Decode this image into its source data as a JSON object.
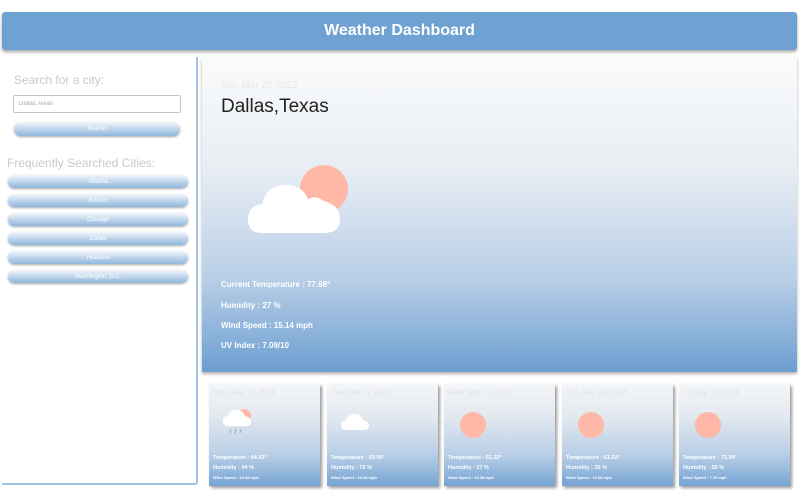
{
  "header": {
    "title": "Weather Dashboard"
  },
  "sidebar": {
    "search_label": "Search for a city:",
    "search_input_value": "Dallas,Texas",
    "search_button": "Search",
    "frequent_label": "Frequently Searched Cities:",
    "cities": [
      "Atlanta",
      "Boston",
      "Chicago",
      "Dallas",
      "Houston",
      "Washington, D.C."
    ]
  },
  "current": {
    "date": "Sun Mar 20 2022",
    "city": "Dallas,Texas",
    "icon": "partly-cloudy-icon",
    "temperature": "Current Temperature : 77.68°",
    "humidity": "Humidity : 27 %",
    "wind": "Wind Speed : 15.14 mph",
    "uv": "UV Index : 7.09/10"
  },
  "forecast": [
    {
      "date": "Mon Mar 21 2022",
      "icon": "rain-cloud-icon",
      "temp": "Temperature : 64.42°",
      "humidity": "Humidity : 94 %",
      "wind": "Wind Speed : 23.08 mph"
    },
    {
      "date": "Tue Mar 22 2022",
      "icon": "cloud-icon",
      "temp": "Temperature : 60.06°",
      "humidity": "Humidity : 72 %",
      "wind": "Wind Speed : 16.68 mph"
    },
    {
      "date": "Wed Mar 23 2022",
      "icon": "sun-icon",
      "temp": "Temperature : 61.32°",
      "humidity": "Humidity : 27 %",
      "wind": "Wind Speed : 13.38 mph"
    },
    {
      "date": "Thu Mar 24 2022",
      "icon": "sun-icon",
      "temp": "Temperature : 61.02°",
      "humidity": "Humidity : 35 %",
      "wind": "Wind Speed : 10.08 mph"
    },
    {
      "date": "Fri Mar 25 2022",
      "icon": "sun-icon",
      "temp": "Temperature : 71.94°",
      "humidity": "Humidity : 25 %",
      "wind": "Wind Speed : 7.76 mph"
    }
  ],
  "colors": {
    "header": "#6fa1d3",
    "sun": "#ffb8a8",
    "accent_border": "#9fc2e3"
  }
}
